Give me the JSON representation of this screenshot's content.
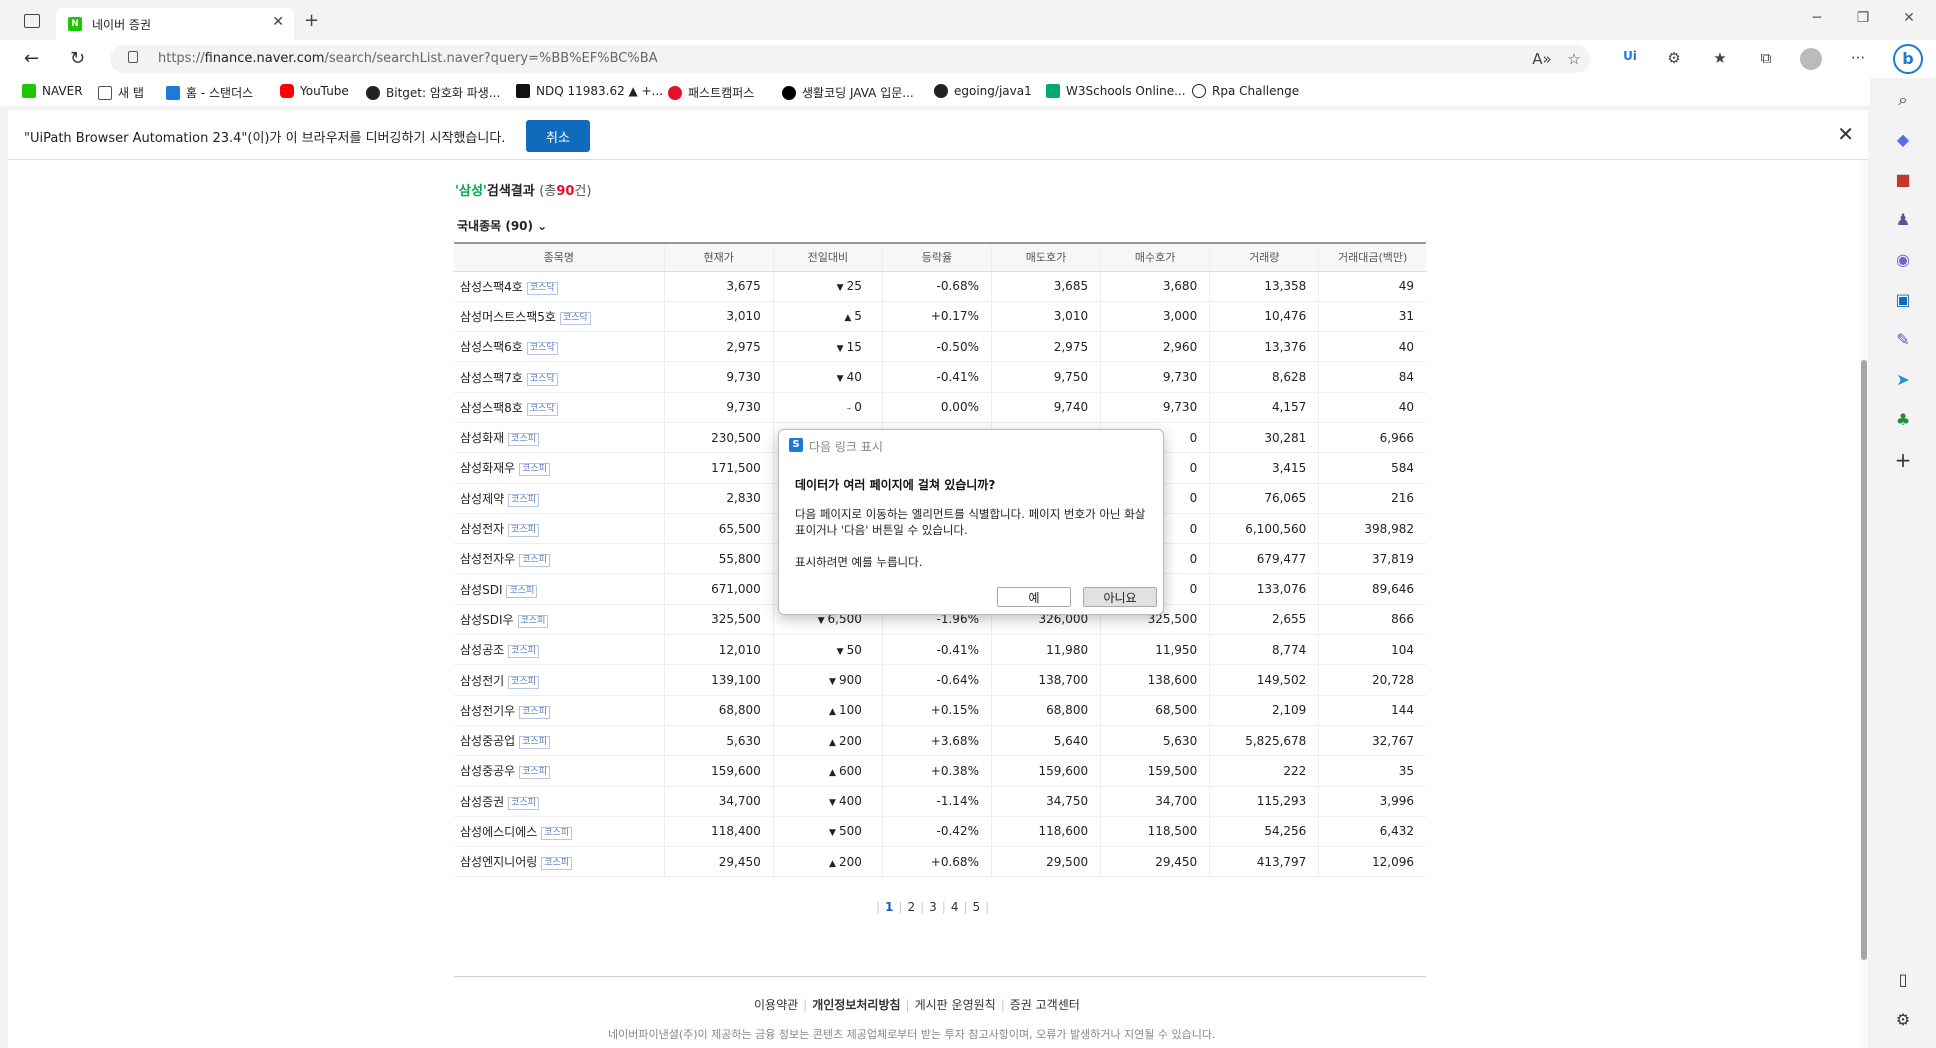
{
  "browser": {
    "tab_title": "네이버 증권",
    "url_prefix": "https://",
    "url_host": "finance.naver.com",
    "url_path": "/search/searchList.naver?query=%BB%EF%BC%BA"
  },
  "bookmarks": [
    {
      "label": "NAVER",
      "color": "#1ec800"
    },
    {
      "label": "새 탭",
      "color": "#555555"
    },
    {
      "label": "홈 - 스탠더스",
      "color": "#1e7ad6"
    },
    {
      "label": "YouTube",
      "color": "#ff0000"
    },
    {
      "label": "Bitget: 암호화 파생...",
      "color": "#222222"
    },
    {
      "label": "NDQ 11983.62 ▲ +...",
      "color": "#111111"
    },
    {
      "label": "패스트캠퍼스",
      "color": "#e3102b"
    },
    {
      "label": "생활코딩 JAVA 입문...",
      "color": "#000000"
    },
    {
      "label": "egoing/java1",
      "color": "#222222"
    },
    {
      "label": "W3Schools Online...",
      "color": "#04aa6d"
    },
    {
      "label": "Rpa Challenge",
      "color": "#222222"
    }
  ],
  "infobar": {
    "text": "\"UiPath Browser Automation 23.4\"(이)가 이 브라우저를 디버깅하기 시작했습니다.",
    "cancel_label": "취소"
  },
  "search": {
    "quote_open": "'",
    "keyword": "삼성",
    "quote_close": "'",
    "result_label": "검색결과",
    "count_prefix": "(총",
    "count": "90",
    "count_suffix": "건)",
    "section": "국내종목 (90) ⌄"
  },
  "table": {
    "headers": [
      "종목명",
      "현재가",
      "전일대비",
      "등락율",
      "매도호가",
      "매수호가",
      "거래량",
      "거래대금(백만)"
    ],
    "rows": [
      {
        "name": "삼성스팩4호",
        "market": "코스닥",
        "price": "3,675",
        "dir": "down",
        "arrow": "▼",
        "change": "25",
        "rate": "-0.68%",
        "ask": "3,685",
        "bid": "3,680",
        "volume": "13,358",
        "amount": "49"
      },
      {
        "name": "삼성머스트스팩5호",
        "market": "코스닥",
        "price": "3,010",
        "dir": "up",
        "arrow": "▲",
        "change": "5",
        "rate": "+0.17%",
        "ask": "3,010",
        "bid": "3,000",
        "volume": "10,476",
        "amount": "31"
      },
      {
        "name": "삼성스팩6호",
        "market": "코스닥",
        "price": "2,975",
        "dir": "down",
        "arrow": "▼",
        "change": "15",
        "rate": "-0.50%",
        "ask": "2,975",
        "bid": "2,960",
        "volume": "13,376",
        "amount": "40"
      },
      {
        "name": "삼성스팩7호",
        "market": "코스닥",
        "price": "9,730",
        "dir": "down",
        "arrow": "▼",
        "change": "40",
        "rate": "-0.41%",
        "ask": "9,750",
        "bid": "9,730",
        "volume": "8,628",
        "amount": "84"
      },
      {
        "name": "삼성스팩8호",
        "market": "코스닥",
        "price": "9,730",
        "dir": "flat",
        "arrow": "–",
        "change": "0",
        "rate": "0.00%",
        "ask": "9,740",
        "bid": "9,730",
        "volume": "4,157",
        "amount": "40"
      },
      {
        "name": "삼성화재",
        "market": "코스피",
        "price": "230,500",
        "dir": "flat",
        "arrow": "",
        "change": "",
        "rate": "",
        "ask": "",
        "bid": "0",
        "volume": "30,281",
        "amount": "6,966"
      },
      {
        "name": "삼성화재우",
        "market": "코스피",
        "price": "171,500",
        "dir": "flat",
        "arrow": "",
        "change": "",
        "rate": "",
        "ask": "",
        "bid": "0",
        "volume": "3,415",
        "amount": "584"
      },
      {
        "name": "삼성제약",
        "market": "코스피",
        "price": "2,830",
        "dir": "flat",
        "arrow": "",
        "change": "",
        "rate": "",
        "ask": "",
        "bid": "0",
        "volume": "76,065",
        "amount": "216"
      },
      {
        "name": "삼성전자",
        "market": "코스피",
        "price": "65,500",
        "dir": "flat",
        "arrow": "",
        "change": "",
        "rate": "",
        "ask": "",
        "bid": "0",
        "volume": "6,100,560",
        "amount": "398,982"
      },
      {
        "name": "삼성전자우",
        "market": "코스피",
        "price": "55,800",
        "dir": "flat",
        "arrow": "",
        "change": "",
        "rate": "",
        "ask": "",
        "bid": "0",
        "volume": "679,477",
        "amount": "37,819"
      },
      {
        "name": "삼성SDI",
        "market": "코스피",
        "price": "671,000",
        "dir": "flat",
        "arrow": "",
        "change": "",
        "rate": "",
        "ask": "",
        "bid": "0",
        "volume": "133,076",
        "amount": "89,646"
      },
      {
        "name": "삼성SDI우",
        "market": "코스피",
        "price": "325,500",
        "dir": "down",
        "arrow": "▼",
        "change": "6,500",
        "rate": "-1.96%",
        "ask": "326,000",
        "bid": "325,500",
        "volume": "2,655",
        "amount": "866"
      },
      {
        "name": "삼성공조",
        "market": "코스피",
        "price": "12,010",
        "dir": "down",
        "arrow": "▼",
        "change": "50",
        "rate": "-0.41%",
        "ask": "11,980",
        "bid": "11,950",
        "volume": "8,774",
        "amount": "104"
      },
      {
        "name": "삼성전기",
        "market": "코스피",
        "price": "139,100",
        "dir": "down",
        "arrow": "▼",
        "change": "900",
        "rate": "-0.64%",
        "ask": "138,700",
        "bid": "138,600",
        "volume": "149,502",
        "amount": "20,728"
      },
      {
        "name": "삼성전기우",
        "market": "코스피",
        "price": "68,800",
        "dir": "up",
        "arrow": "▲",
        "change": "100",
        "rate": "+0.15%",
        "ask": "68,800",
        "bid": "68,500",
        "volume": "2,109",
        "amount": "144"
      },
      {
        "name": "삼성중공업",
        "market": "코스피",
        "price": "5,630",
        "dir": "up",
        "arrow": "▲",
        "change": "200",
        "rate": "+3.68%",
        "ask": "5,640",
        "bid": "5,630",
        "volume": "5,825,678",
        "amount": "32,767"
      },
      {
        "name": "삼성중공우",
        "market": "코스피",
        "price": "159,600",
        "dir": "up",
        "arrow": "▲",
        "change": "600",
        "rate": "+0.38%",
        "ask": "159,600",
        "bid": "159,500",
        "volume": "222",
        "amount": "35"
      },
      {
        "name": "삼성증권",
        "market": "코스피",
        "price": "34,700",
        "dir": "down",
        "arrow": "▼",
        "change": "400",
        "rate": "-1.14%",
        "ask": "34,750",
        "bid": "34,700",
        "volume": "115,293",
        "amount": "3,996"
      },
      {
        "name": "삼성에스디에스",
        "market": "코스피",
        "price": "118,400",
        "dir": "down",
        "arrow": "▼",
        "change": "500",
        "rate": "-0.42%",
        "ask": "118,600",
        "bid": "118,500",
        "volume": "54,256",
        "amount": "6,432"
      },
      {
        "name": "삼성엔지니어링",
        "market": "코스피",
        "price": "29,450",
        "dir": "up",
        "arrow": "▲",
        "change": "200",
        "rate": "+0.68%",
        "ask": "29,500",
        "bid": "29,450",
        "volume": "413,797",
        "amount": "12,096"
      }
    ]
  },
  "paging": {
    "pages": [
      "1",
      "2",
      "3",
      "4",
      "5"
    ],
    "current": "1"
  },
  "footer": {
    "links": [
      "이용약관",
      "개인정보처리방침",
      "게시판 운영원칙",
      "증권 고객센터"
    ],
    "disclaimer": "네이버파이낸셜(주)이 제공하는 금융 정보는 콘텐츠 제공업체로부터 받는 투자 참고사항이며, 오류가 발생하거나 지연될 수 있습니다."
  },
  "dialog": {
    "title": "다음 링크 표시",
    "heading": "데이터가 여러 페이지에 걸쳐 있습니까?",
    "body": "다음 페이지로 이동하는 엘리먼트를 식별합니다. 페이지 번호가 아닌 화살표이거나 '다음' 버튼일 수 있습니다.",
    "body2": "표시하려면 예를 누릅니다.",
    "yes_label": "예",
    "no_label": "아니요"
  },
  "colors": {
    "up": "#e3102b",
    "down": "#1f5cc8",
    "naver_green": "#00a84b",
    "accent": "#0f6cbd"
  }
}
